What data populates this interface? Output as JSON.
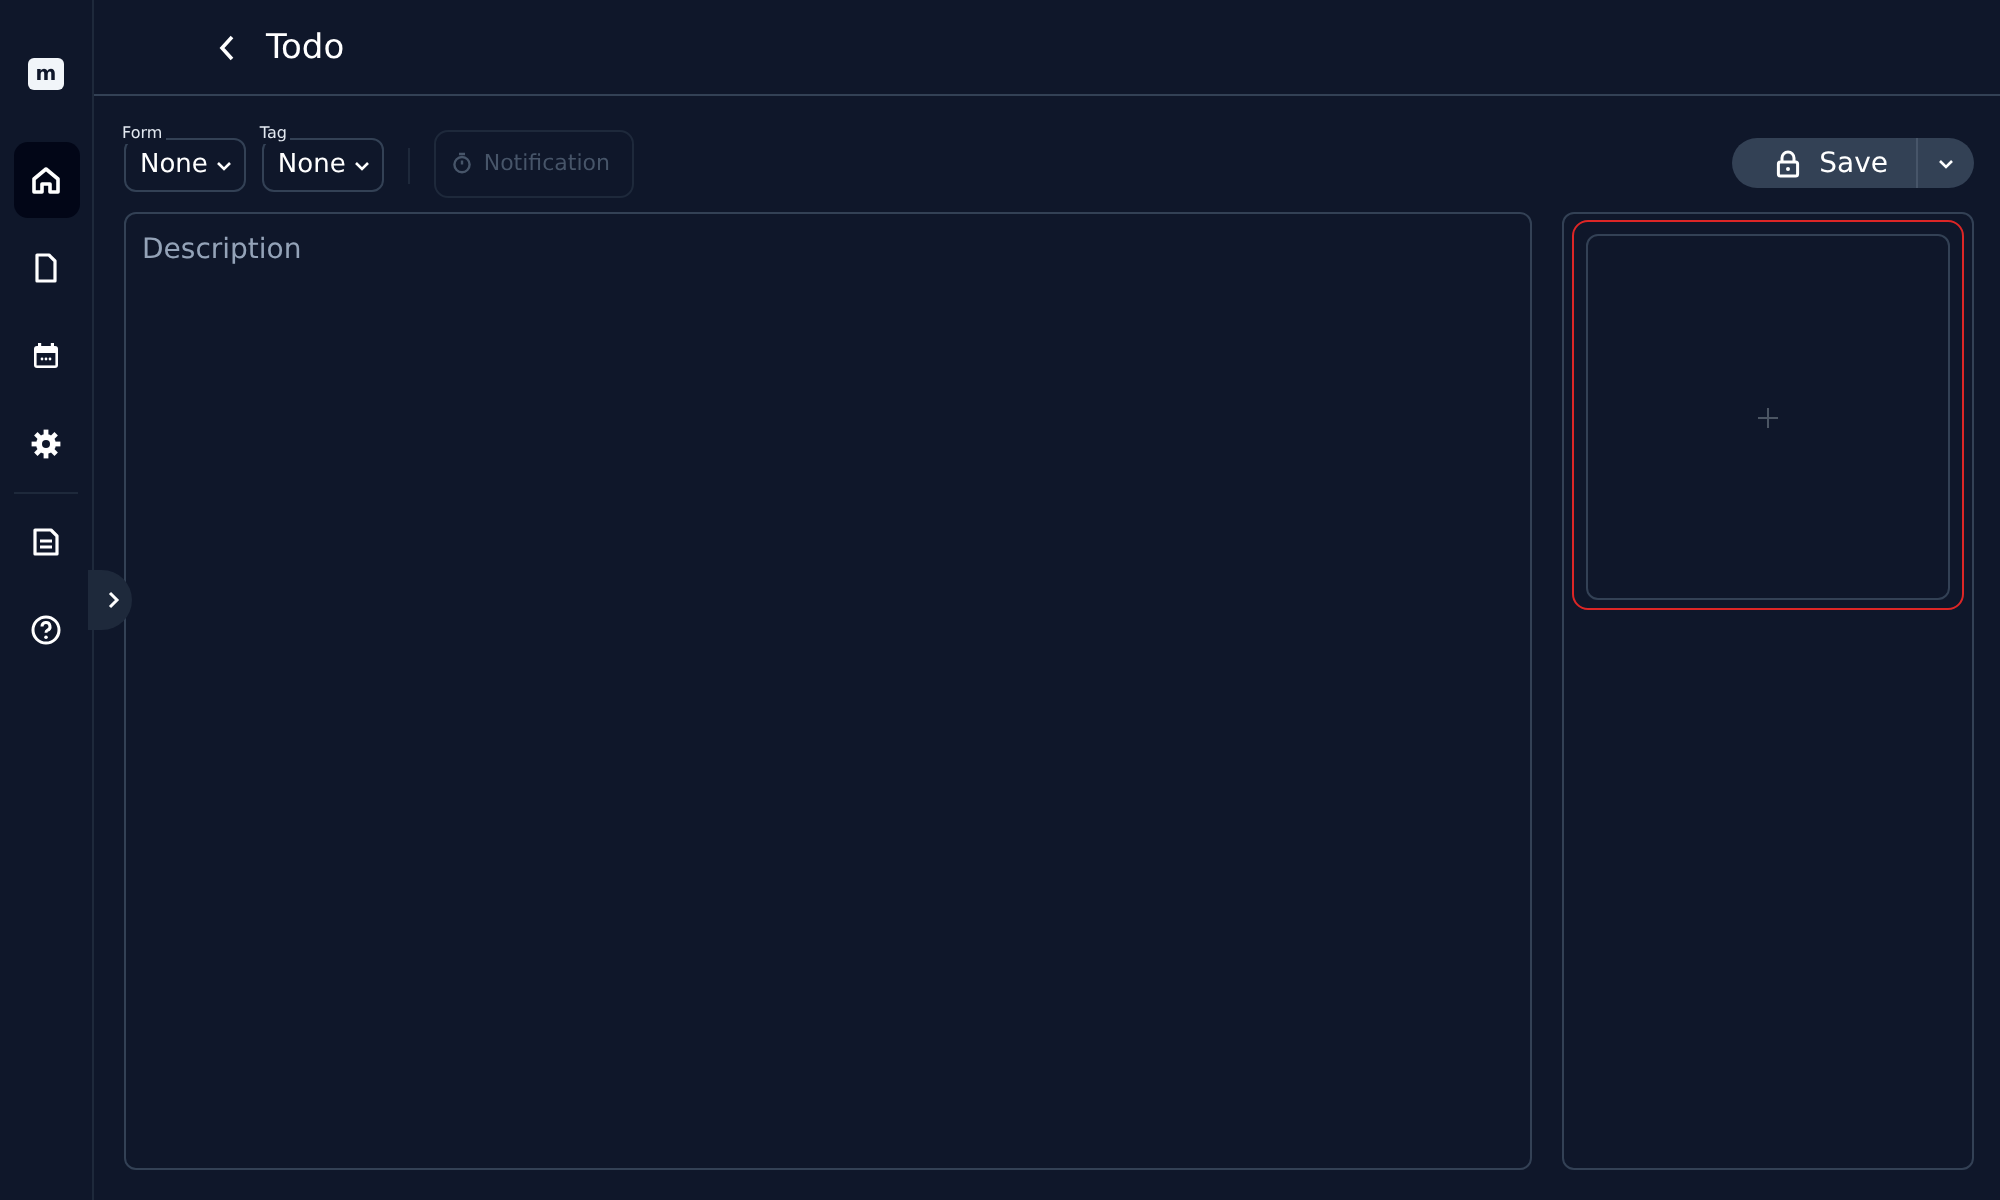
{
  "logo": {
    "text": "m"
  },
  "sidebar": {
    "items": [
      {
        "kind": "home",
        "selected": true
      },
      {
        "kind": "file",
        "selected": false
      },
      {
        "kind": "calendar",
        "selected": false
      },
      {
        "kind": "settings",
        "selected": false
      },
      {
        "kind": "divider"
      },
      {
        "kind": "document",
        "selected": false
      },
      {
        "kind": "help",
        "selected": false
      }
    ]
  },
  "header": {
    "title": "Todo"
  },
  "toolbar": {
    "selects": [
      {
        "label": "Form",
        "value": "None"
      },
      {
        "label": "Tag",
        "value": "None"
      }
    ],
    "notification": {
      "label": "Notification",
      "disabled": true
    },
    "save": {
      "label": "Save",
      "locked": true
    }
  },
  "editor": {
    "placeholder": "Description"
  }
}
